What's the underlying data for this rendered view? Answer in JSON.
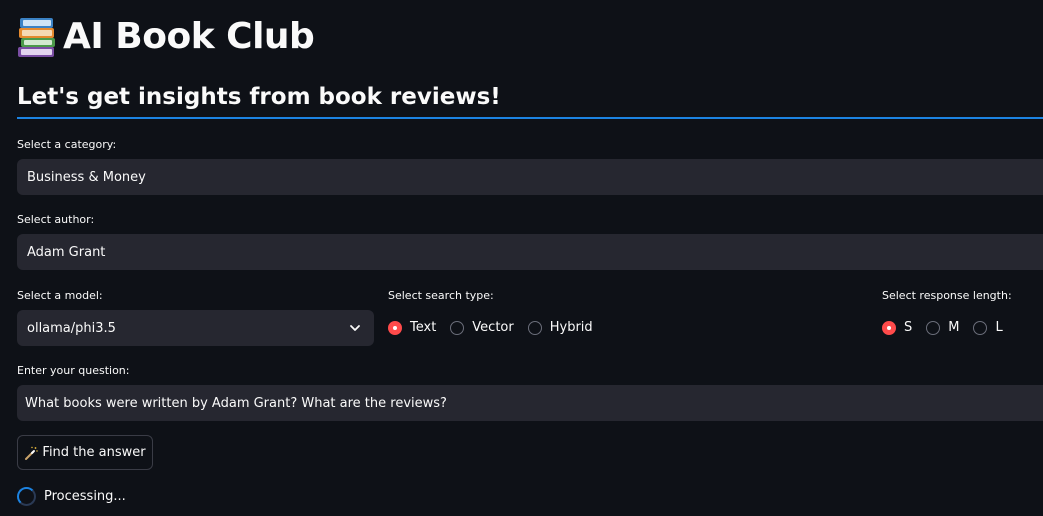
{
  "app": {
    "title": "AI Book Club",
    "title_icon": "books-icon",
    "subheader": "Let's get insights from book reviews!",
    "accent_color": "#1c83e1",
    "primary_color": "#ff4b4b"
  },
  "category": {
    "label": "Select a category:",
    "value": "Business & Money"
  },
  "author": {
    "label": "Select author:",
    "value": "Adam Grant"
  },
  "model": {
    "label": "Select a model:",
    "value": "ollama/phi3.5"
  },
  "search_type": {
    "label": "Select search type:",
    "options": [
      "Text",
      "Vector",
      "Hybrid"
    ],
    "selected": "Text"
  },
  "response_length": {
    "label": "Select response length:",
    "options": [
      "S",
      "M",
      "L"
    ],
    "selected": "S"
  },
  "question": {
    "label": "Enter your question:",
    "value": "What books were written by Adam Grant? What are the reviews?"
  },
  "find_button": {
    "label": "Find the answer",
    "icon": "magic-wand-icon"
  },
  "status": {
    "text": "Processing..."
  }
}
